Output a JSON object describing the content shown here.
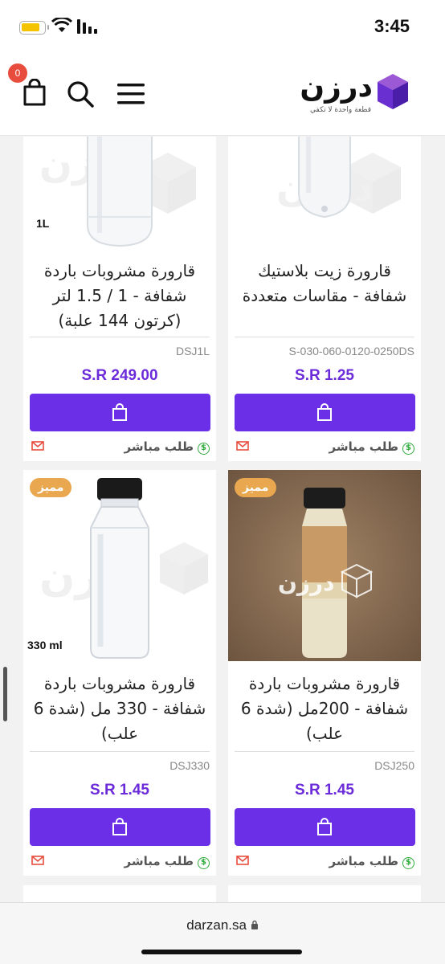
{
  "status": {
    "time": "3:45"
  },
  "header": {
    "cart_count": "0",
    "logo_text": "درزن",
    "logo_tagline": "قطعة واحدة لا تكفي"
  },
  "products": [
    {
      "title": "قارورة زيت بلاستيك شفافة - مقاسات متعددة",
      "sku": "S-030-060-0120-0250DS",
      "price": "S.R 1.25",
      "direct_order": "طلب مباشر",
      "badge": "",
      "volume_label": ""
    },
    {
      "title": "قارورة مشروبات باردة شفافة - 1 / 1.5 لتر (كرتون 144 علبة)",
      "sku": "DSJ1L",
      "price": "S.R 249.00",
      "direct_order": "طلب مباشر",
      "badge": "",
      "volume_label": "1L"
    },
    {
      "title": "قارورة مشروبات باردة شفافة - 200مل (شدة 6 علب)",
      "sku": "DSJ250",
      "price": "S.R 1.45",
      "direct_order": "طلب مباشر",
      "badge": "مميز",
      "volume_label": ""
    },
    {
      "title": "قارورة مشروبات باردة شفافة - 330 مل (شدة 6 علب)",
      "sku": "DSJ330",
      "price": "S.R 1.45",
      "direct_order": "طلب مباشر",
      "badge": "مميز",
      "volume_label": "330 ml"
    }
  ],
  "browser": {
    "url": "darzan.sa"
  },
  "colors": {
    "accent": "#6a2fe6",
    "price": "#6b2bd9",
    "badge": "#e9a850",
    "cart_badge": "#e74c3c"
  }
}
